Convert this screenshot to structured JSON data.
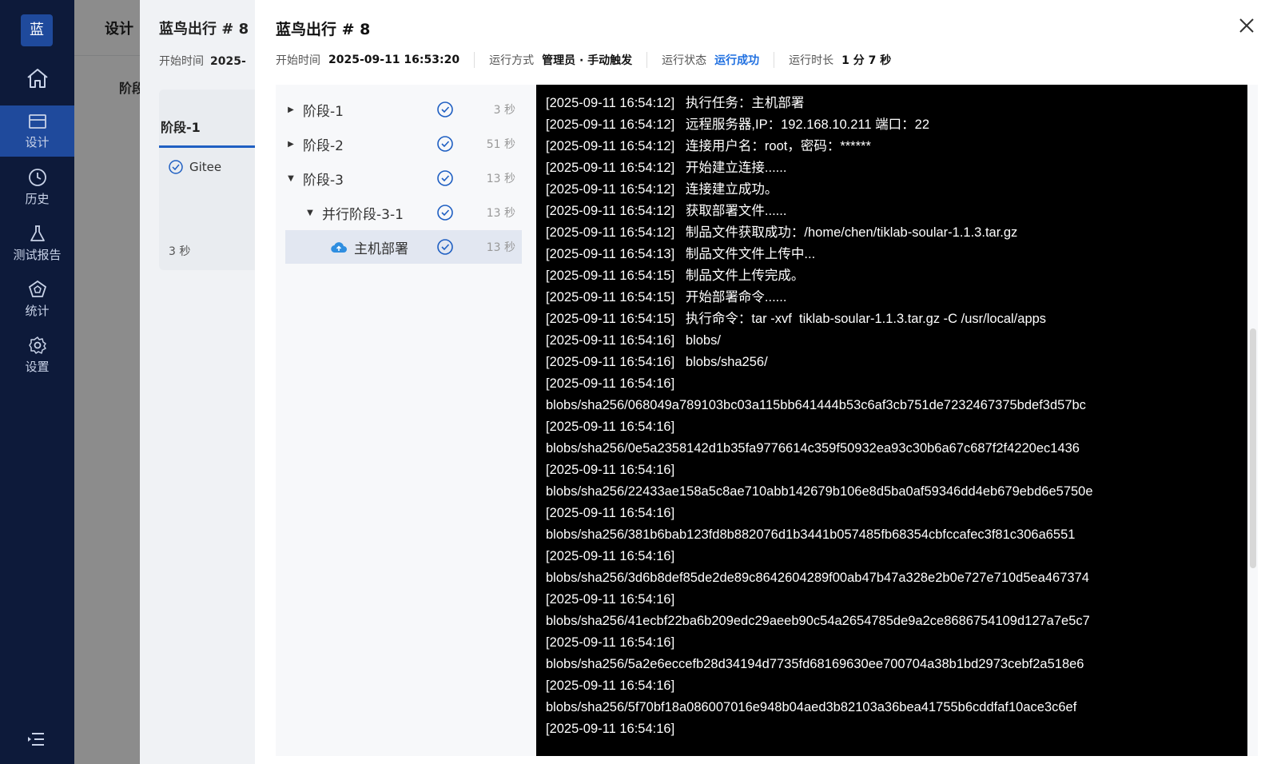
{
  "nav": {
    "logo_text": "蓝",
    "items": [
      {
        "label": "设计",
        "icon": "design-icon",
        "active": true
      },
      {
        "label": "历史",
        "icon": "clock-icon",
        "active": false
      },
      {
        "label": "测试报告",
        "icon": "flask-icon",
        "active": false
      },
      {
        "label": "统计",
        "icon": "stats-icon",
        "active": false
      },
      {
        "label": "设置",
        "icon": "gear-icon",
        "active": false
      }
    ]
  },
  "background": {
    "tab_design": "设计",
    "stage_label": "阶段"
  },
  "run_panel": {
    "title": "蓝鸟出行 # 8",
    "start_label": "开始时间",
    "start_value": "2025-",
    "stage": "阶段-1",
    "task": "Gitee",
    "duration": "3 秒"
  },
  "drawer": {
    "title": "蓝鸟出行 # 8",
    "meta": {
      "start_label": "开始时间",
      "start_value": "2025-09-11 16:53:20",
      "mode_label": "运行方式",
      "mode_value": "管理员 · 手动触发",
      "status_label": "运行状态",
      "status_value": "运行成功",
      "duration_label": "运行时长",
      "duration_value": "1 分 7 秒"
    },
    "status_color": "#1f6fe0",
    "tree": [
      {
        "name": "阶段-1",
        "time": "3 秒",
        "caret": "right",
        "level": 0
      },
      {
        "name": "阶段-2",
        "time": "51 秒",
        "caret": "right",
        "level": 0
      },
      {
        "name": "阶段-3",
        "time": "13 秒",
        "caret": "down",
        "level": 0
      },
      {
        "name": "并行阶段-3-1",
        "time": "13 秒",
        "caret": "down",
        "level": 1
      },
      {
        "name": "主机部署",
        "time": "13 秒",
        "caret": "none",
        "level": 2
      }
    ],
    "log": [
      "[2025-09-11 16:54:12]   执行任务：主机部署",
      "[2025-09-11 16:54:12]   远程服务器,IP：192.168.10.211 端口：22",
      "[2025-09-11 16:54:12]   连接用户名：root，密码：******",
      "[2025-09-11 16:54:12]   开始建立连接......",
      "[2025-09-11 16:54:12]   连接建立成功。",
      "[2025-09-11 16:54:12]   获取部署文件......",
      "[2025-09-11 16:54:12]   制品文件获取成功：/home/chen/tiklab-soular-1.1.3.tar.gz",
      "[2025-09-11 16:54:13]   制品文件文件上传中...",
      "[2025-09-11 16:54:15]   制品文件上传完成。",
      "[2025-09-11 16:54:15]   开始部署命令......",
      "[2025-09-11 16:54:15]   执行命令：tar -xvf  tiklab-soular-1.1.3.tar.gz -C /usr/local/apps",
      "[2025-09-11 16:54:16]   blobs/",
      "[2025-09-11 16:54:16]   blobs/sha256/",
      "[2025-09-11 16:54:16]",
      "blobs/sha256/068049a789103bc03a115bb641444b53c6af3cb751de7232467375bdef3d57bc",
      "[2025-09-11 16:54:16]",
      "blobs/sha256/0e5a2358142d1b35fa9776614c359f50932ea93c30b6a67c687f2f4220ec1436",
      "[2025-09-11 16:54:16]",
      "blobs/sha256/22433ae158a5c8ae710abb142679b106e8d5ba0af59346dd4eb679ebd6e5750e",
      "[2025-09-11 16:54:16]",
      "blobs/sha256/381b6bab123fd8b882076d1b3441b057485fb68354cbfccafec3f81c306a6551",
      "[2025-09-11 16:54:16]",
      "blobs/sha256/3d6b8def85de2de89c8642604289f00ab47b47a328e2b0e727e710d5ea467374",
      "[2025-09-11 16:54:16]",
      "blobs/sha256/41ecbf22ba6b209edc29aeeb90c54a2654785de9a2ce8686754109d127a7e5c7",
      "[2025-09-11 16:54:16]",
      "blobs/sha256/5a2e6eccefb28d34194d7735fd68169630ee700704a38b1bd2973cebf2a518e6",
      "[2025-09-11 16:54:16]",
      "blobs/sha256/5f70bf18a086007016e948b04aed3b82103a36bea41755b6cddfaf10ace3c6ef",
      "[2025-09-11 16:54:16]"
    ]
  }
}
